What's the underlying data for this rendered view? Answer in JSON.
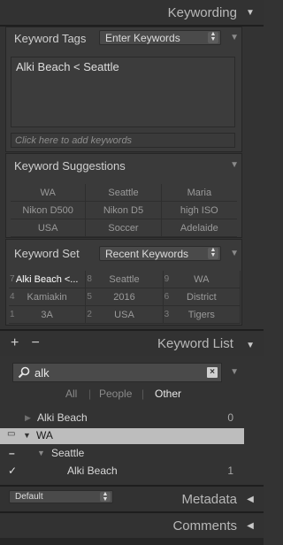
{
  "keywording": {
    "title": "Keywording",
    "keyword_tags": {
      "label": "Keyword Tags",
      "mode": "Enter Keywords",
      "keywords": "Alki Beach < Seattle",
      "add_placeholder": "Click here to add keywords"
    },
    "suggestions": {
      "label": "Keyword Suggestions",
      "items": [
        "WA",
        "Seattle",
        "Maria",
        "Nikon D500",
        "Nikon D5",
        "high ISO",
        "USA",
        "Soccer",
        "Adelaide"
      ]
    },
    "keyword_set": {
      "label": "Keyword Set",
      "selected": "Recent Keywords",
      "items": [
        {
          "num": "7",
          "label": "Alki Beach <...",
          "selected": true
        },
        {
          "num": "8",
          "label": "Seattle",
          "selected": false
        },
        {
          "num": "9",
          "label": "WA",
          "selected": false
        },
        {
          "num": "4",
          "label": "Kamiakin",
          "selected": false
        },
        {
          "num": "5",
          "label": "2016",
          "selected": false
        },
        {
          "num": "6",
          "label": "District",
          "selected": false
        },
        {
          "num": "1",
          "label": "3A",
          "selected": false
        },
        {
          "num": "2",
          "label": "USA",
          "selected": false
        },
        {
          "num": "3",
          "label": "Tigers",
          "selected": false
        }
      ]
    }
  },
  "keyword_list": {
    "title": "Keyword List",
    "add": "+",
    "remove": "−",
    "search_value": "alk",
    "filters": {
      "all": "All",
      "people": "People",
      "other": "Other",
      "divider": "|",
      "active": "other"
    },
    "rows": [
      {
        "label": "Alki Beach",
        "count": "0"
      },
      {
        "label": "WA",
        "count": ""
      },
      {
        "label": "Seattle",
        "count": ""
      },
      {
        "label": "Alki Beach",
        "count": "1"
      }
    ]
  },
  "metadata": {
    "preset": "Default",
    "title": "Metadata"
  },
  "comments": {
    "title": "Comments"
  },
  "colors": {
    "panel_bg": "#333333",
    "highlight_row": "#bdbdbd",
    "text_selected": "#ffffff"
  }
}
